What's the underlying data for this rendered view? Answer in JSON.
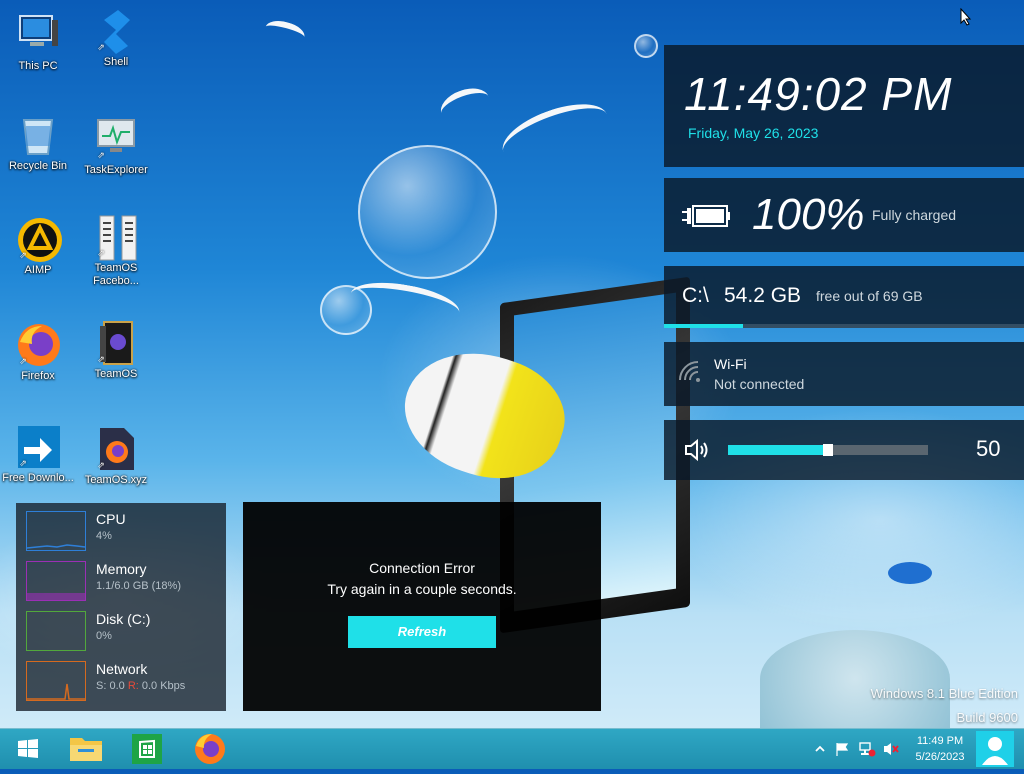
{
  "desktop_icons": [
    {
      "id": "this-pc",
      "label": "This PC",
      "icon": "computer-icon"
    },
    {
      "id": "shell",
      "label": "Shell",
      "icon": "shell-icon"
    },
    {
      "id": "recycle-bin",
      "label": "Recycle Bin",
      "icon": "recycle-bin-icon"
    },
    {
      "id": "taskexplorer",
      "label": "TaskExplorer",
      "icon": "monitor-icon"
    },
    {
      "id": "aimp",
      "label": "AIMP",
      "icon": "aimp-icon"
    },
    {
      "id": "teamos-facebook",
      "label": "TeamOS Facebo...",
      "icon": "document-icon"
    },
    {
      "id": "firefox",
      "label": "Firefox",
      "icon": "firefox-icon"
    },
    {
      "id": "teamos",
      "label": "TeamOS",
      "icon": "book-icon"
    },
    {
      "id": "free-download",
      "label": "Free Downlo...",
      "icon": "download-icon"
    },
    {
      "id": "teamos-xyz",
      "label": "TeamOS.xyz",
      "icon": "firefox-file-icon"
    }
  ],
  "clock": {
    "time": "11:49:02 PM",
    "date": "Friday, May 26, 2023"
  },
  "battery": {
    "percent": "100%",
    "status": "Fully charged",
    "level": 1.0
  },
  "disk": {
    "path": "C:\\",
    "free": "54.2 GB",
    "total": "free out of 69 GB",
    "used_fraction": 0.22
  },
  "wifi": {
    "name": "Wi-Fi",
    "status": "Not connected"
  },
  "volume": {
    "value": "50",
    "level": 0.5
  },
  "resources": [
    {
      "name": "CPU",
      "value": "4%",
      "color": "#2e7fd8"
    },
    {
      "name": "Memory",
      "value": "1.1/6.0 GB (18%)",
      "color": "#9b2fb5"
    },
    {
      "name": "Disk (C:)",
      "value": "0%",
      "color": "#52a83c"
    },
    {
      "name": "Network",
      "value_s": "S: 0.0",
      "value_r_label": "R:",
      "value_r": " 0.0 Kbps",
      "color": "#d56a1f"
    }
  ],
  "connection_error": {
    "title": "Connection Error",
    "message": "Try again in a couple seconds.",
    "button": "Refresh"
  },
  "watermark": {
    "line1": "Windows 8.1 Blue Edition",
    "line2": "Build 9600"
  },
  "taskbar": {
    "pinned": [
      {
        "id": "start",
        "icon": "windows-logo-icon"
      },
      {
        "id": "file-explorer",
        "icon": "folder-icon"
      },
      {
        "id": "store",
        "icon": "store-icon"
      },
      {
        "id": "firefox",
        "icon": "firefox-icon"
      }
    ],
    "tray_time": "11:49 PM",
    "tray_date": "5/26/2023"
  },
  "colors": {
    "accent": "#1fe0e8",
    "widget_bg": "#0a1928",
    "taskbar": "#2fa7c4"
  }
}
